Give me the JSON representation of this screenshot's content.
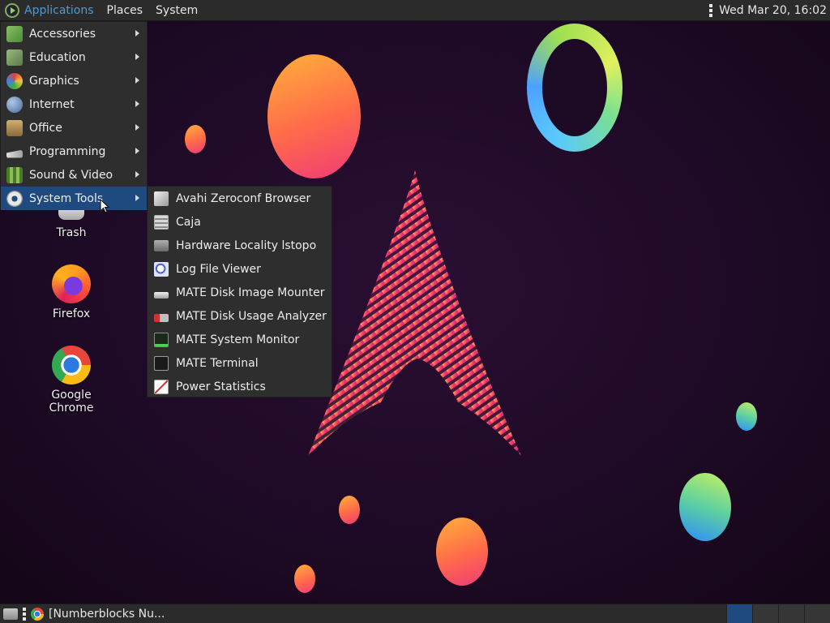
{
  "top_panel": {
    "menus": [
      "Applications",
      "Places",
      "System"
    ],
    "clock": "Wed Mar 20, 16:02"
  },
  "main_menu": {
    "items": [
      {
        "label": "Accessories",
        "icon": "accessories-icon",
        "color": "#6fae4f"
      },
      {
        "label": "Education",
        "icon": "education-icon",
        "color": "#7a9a5a"
      },
      {
        "label": "Graphics",
        "icon": "graphics-icon",
        "color": "#e0a040"
      },
      {
        "label": "Internet",
        "icon": "internet-icon",
        "color": "#4a7ab0"
      },
      {
        "label": "Office",
        "icon": "office-icon",
        "color": "#c0a060"
      },
      {
        "label": "Programming",
        "icon": "programming-icon",
        "color": "#cccccc"
      },
      {
        "label": "Sound & Video",
        "icon": "sound-video-icon",
        "color": "#6a9a3a"
      },
      {
        "label": "System Tools",
        "icon": "system-tools-icon",
        "color": "#dddddd"
      }
    ],
    "active_index": 7
  },
  "sub_menu": {
    "items": [
      {
        "label": "Avahi Zeroconf Browser",
        "icon": "avahi-icon"
      },
      {
        "label": "Caja",
        "icon": "file-manager-icon"
      },
      {
        "label": "Hardware Locality lstopo",
        "icon": "hardware-icon"
      },
      {
        "label": "Log File Viewer",
        "icon": "log-viewer-icon"
      },
      {
        "label": "MATE Disk Image Mounter",
        "icon": "disk-mounter-icon"
      },
      {
        "label": "MATE Disk Usage Analyzer",
        "icon": "disk-usage-icon"
      },
      {
        "label": "MATE System Monitor",
        "icon": "system-monitor-icon"
      },
      {
        "label": "MATE Terminal",
        "icon": "terminal-icon"
      },
      {
        "label": "Power Statistics",
        "icon": "power-stats-icon"
      }
    ]
  },
  "desktop_icons": [
    {
      "label": "Trash",
      "icon": "trash-icon"
    },
    {
      "label": "Firefox",
      "icon": "firefox-icon"
    },
    {
      "label": "Google Chrome",
      "icon": "chrome-icon"
    }
  ],
  "bottom_panel": {
    "task_label": "[Numberblocks Nu...",
    "workspaces": 4,
    "active_workspace": 0
  },
  "colors": {
    "accent": "#1f4a80",
    "menu_link": "#4a9ad9",
    "panel_bg": "#2b2b2b",
    "menu_bg": "#2e2e2e"
  }
}
